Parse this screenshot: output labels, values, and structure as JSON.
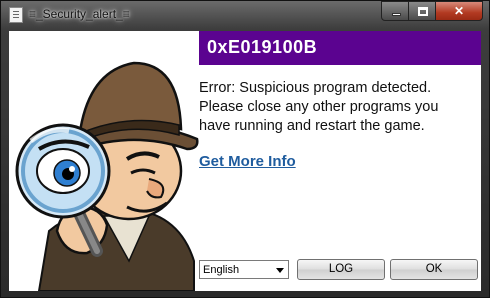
{
  "window": {
    "title": "≡_Security_alert_≡",
    "minimize_glyph": "",
    "maximize_glyph": "",
    "close_glyph": "✕"
  },
  "alert": {
    "code": "0xE019100B",
    "message_lines": [
      "Error: Suspicious program detected.",
      "Please close any other programs you",
      "have running and restart the game."
    ],
    "link_label": "Get More Info"
  },
  "footer": {
    "language_selected": "English",
    "log_label": "LOG",
    "ok_label": "OK"
  },
  "colors": {
    "banner": "#5b0390",
    "link": "#1f5c9e",
    "close_button": "#b23a22"
  },
  "icons": {
    "illustration": "detective-with-magnifying-glass"
  }
}
